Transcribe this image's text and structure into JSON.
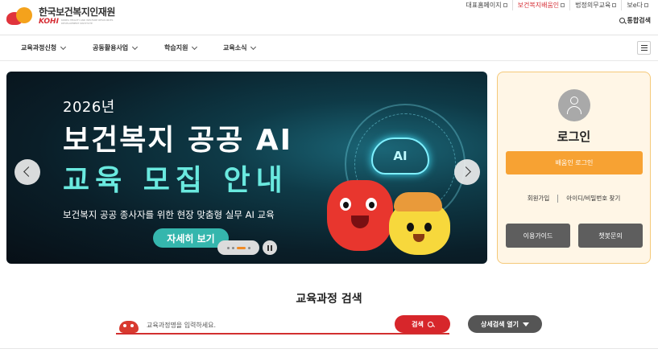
{
  "header": {
    "logo_ko": "한국보건복지인재원",
    "logo_en": "KOHI",
    "logo_sub": "KOREA HEALTH AND WELFARE RESOURCES DEVELOPMENT INSTITUTE",
    "util_links": [
      "대표홈페이지",
      "보건복지배움인",
      "법정의무교육",
      "보e다"
    ],
    "unified_search": "통합검색"
  },
  "gnb": {
    "items": [
      "교육과정신청",
      "공동활용사업",
      "학습지원",
      "교육소식"
    ]
  },
  "banner": {
    "year": "2026년",
    "title_line1": "보건복지 공공 AI",
    "title_line2": "교육 모집 안내",
    "subtitle": "보건복지 공공 종사자를 위한 현장 맞춤형 실무 AI 교육",
    "cta": "자세히 보기",
    "ai_badge": "AI",
    "slide_index": 3,
    "slide_count": 4
  },
  "login": {
    "title": "로그인",
    "login_button": "배움인 로그인",
    "join": "회원가입",
    "find": "아이디/비밀번호 찾기",
    "guide_button": "이용가이드",
    "chatbot_button": "챗봇문의"
  },
  "course_search": {
    "title": "교육과정 검색",
    "placeholder": "교육과정명을 입력하세요.",
    "search_button": "검색",
    "advanced_button": "상세검색 열기"
  },
  "colors": {
    "brand_red": "#d7262b",
    "brand_orange": "#f7a233",
    "banner_accent": "#6ae9df"
  }
}
